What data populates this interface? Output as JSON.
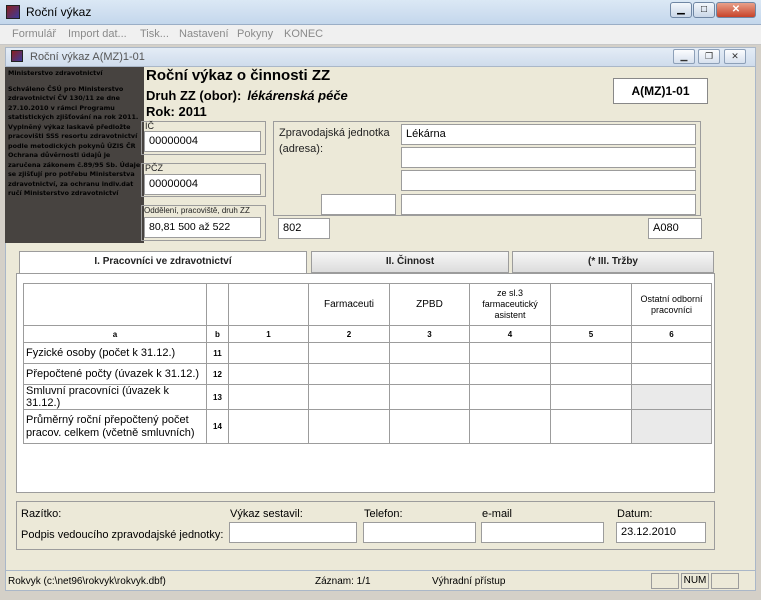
{
  "window": {
    "title": "Roční výkaz"
  },
  "menu": {
    "items": [
      "Formulář",
      "Import dat...",
      "Tisk...",
      "Nastavení",
      "Pokyny",
      "KONEC"
    ]
  },
  "inner_window": {
    "title": "Roční výkaz A(MZ)1-01"
  },
  "left_note": {
    "line1": "Ministerstvo zdravotnictví",
    "body": "Schváleno ČSÚ pro Ministerstvo zdravotnictví ČV 130/11 ze dne 27.10.2010 v rámci Programu statistických zjišťování na rok 2011. Vyplněný výkaz laskavě předložte pracovišti SSS resortu zdravotnictví podle metodických pokynů ÚZIS ČR Ochrana důvěrnosti údajů je zaručena zákonem č.89/95 Sb. Údaje se zjišťují pro potřebu Ministerstva zdravotnictví, za ochranu indiv.dat ručí Ministerstvo zdravotnictví"
  },
  "header": {
    "title": "Roční výkaz o činnosti ZZ",
    "druh_label": "Druh ZZ (obor):",
    "druh_value": "lékárenská péče",
    "year": "Rok: 2011",
    "form_code": "A(MZ)1-01"
  },
  "ic": {
    "label": "IČ",
    "value": "00000004"
  },
  "pcz": {
    "label": "PČZ",
    "value": "00000004"
  },
  "oddeleni": {
    "label": "Oddělení, pracoviště, druh ZZ",
    "value": "80,81  500 až 522"
  },
  "jednotka": {
    "label1": "Zpravodajská jednotka",
    "label2": "(adresa):",
    "line1": "Lékárna",
    "code": "802",
    "code2": "A080"
  },
  "tabs": [
    "I. Pracovníci ve zdravotnictví",
    "II. Činnost",
    "(* III. Tržby"
  ],
  "table": {
    "headers": [
      "",
      "",
      "",
      "Farmaceuti",
      "ZPBD",
      "ze sl.3 farmaceutický asistent",
      "",
      "Ostatní odborní pracovníci"
    ],
    "labels": [
      "a",
      "b",
      "1",
      "2",
      "3",
      "4",
      "5",
      "6"
    ],
    "rows": [
      {
        "label": "Fyzické osoby (počet k 31.12.)",
        "num": "11"
      },
      {
        "label": "Přepočtené počty (úvazek k 31.12.)",
        "num": "12"
      },
      {
        "label": "Smluvní pracovníci (úvazek k 31.12.)",
        "num": "13"
      },
      {
        "label": "Průměrný roční přepočtený počet pracov. celkem (včetně smluvních)",
        "num": "14"
      }
    ]
  },
  "bottom": {
    "razitko": "Razítko:",
    "podpis": "Podpis vedoucího zpravodajské jednotky:",
    "sestavil": "Výkaz sestavil:",
    "telefon": "Telefon:",
    "email": "e-mail",
    "datum_label": "Datum:",
    "datum_value": "23.12.2010"
  },
  "status": {
    "path": "Rokvyk (c:\\net96\\rokvyk\\rokvyk.dbf)",
    "zaznam": "Záznam: 1/1",
    "pristup": "Výhradní přístup",
    "num": "NUM"
  }
}
